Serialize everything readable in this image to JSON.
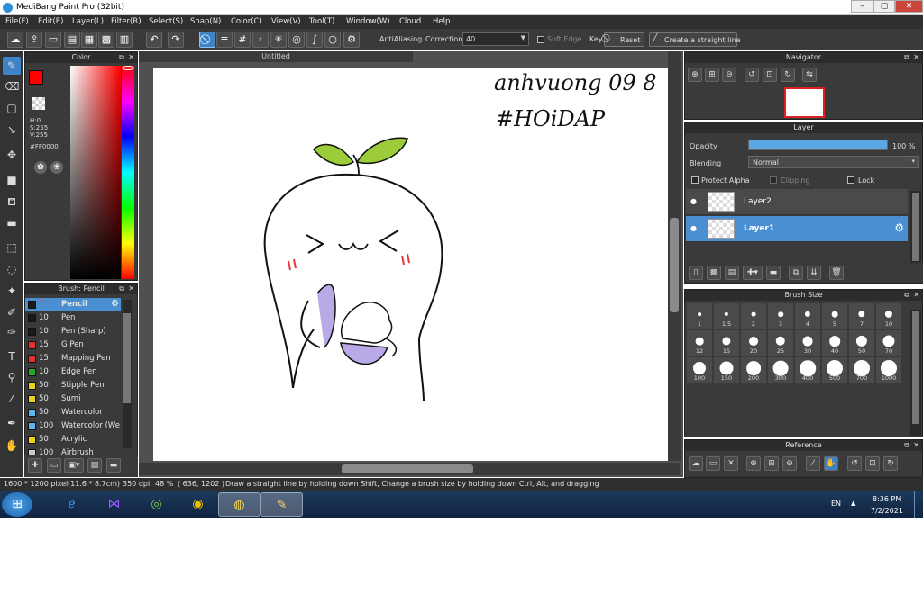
{
  "window": {
    "title": "MediBang Paint Pro (32bit)",
    "min": "–",
    "max": "▢",
    "close": "✕"
  },
  "menu": [
    "File(F)",
    "Edit(E)",
    "Layer(L)",
    "Filter(R)",
    "Select(S)",
    "Snap(N)",
    "Color(C)",
    "View(V)",
    "Tool(T)",
    "Window(W)",
    "Cloud",
    "Help"
  ],
  "toolbar": {
    "antialiasing_label": "AntiAliasing",
    "correction_label": "Correction",
    "correction_value": "40",
    "soft_edge_label": "Soft Edge",
    "key_label": "Key",
    "reset_label": "Reset",
    "straight_line_label": "Create a straight line"
  },
  "color_panel": {
    "title": "Color",
    "h": "H:0",
    "s": "S:255",
    "v": "V:255",
    "hex": "#FF0000",
    "primary": "#ff0000"
  },
  "brush_panel": {
    "title": "Brush: Pencil",
    "items": [
      {
        "size": "7",
        "name": "Pencil",
        "color": "#1a1a1a"
      },
      {
        "size": "10",
        "name": "Pen",
        "color": "#1a1a1a"
      },
      {
        "size": "10",
        "name": "Pen (Sharp)",
        "color": "#1a1a1a"
      },
      {
        "size": "15",
        "name": "G Pen",
        "color": "#e53030"
      },
      {
        "size": "15",
        "name": "Mapping Pen",
        "color": "#e53030"
      },
      {
        "size": "10",
        "name": "Edge Pen",
        "color": "#27a827"
      },
      {
        "size": "50",
        "name": "Stipple Pen",
        "color": "#e8d21f"
      },
      {
        "size": "50",
        "name": "Sumi",
        "color": "#e8d21f"
      },
      {
        "size": "50",
        "name": "Watercolor",
        "color": "#5fb6ee"
      },
      {
        "size": "100",
        "name": "Watercolor (We",
        "color": "#5fb6ee"
      },
      {
        "size": "50",
        "name": "Acrylic",
        "color": "#e8d21f"
      },
      {
        "size": "100",
        "name": "Airbrush",
        "color": "#cccccc"
      }
    ]
  },
  "canvas": {
    "tab": "Untitled",
    "handwriting_line1": "anhvuong 09 8",
    "handwriting_line2": "#HOiDAP"
  },
  "navigator": {
    "title": "Navigator"
  },
  "layer_panel": {
    "title": "Layer",
    "opacity_label": "Opacity",
    "opacity_value": "100 %",
    "opacity_fraction": 1.0,
    "blending_label": "Blending",
    "blending_value": "Normal",
    "protect_alpha": "Protect Alpha",
    "clipping": "Clipping",
    "lock": "Lock",
    "layers": [
      "Layer2",
      "Layer1"
    ]
  },
  "brush_size": {
    "title": "Brush Size",
    "sizes": [
      "1",
      "1.5",
      "2",
      "3",
      "4",
      "5",
      "7",
      "10",
      "12",
      "15",
      "20",
      "25",
      "30",
      "40",
      "50",
      "70",
      "100",
      "150",
      "200",
      "300",
      "400",
      "500",
      "700",
      "1000"
    ]
  },
  "reference": {
    "title": "Reference"
  },
  "status": {
    "size": "1600 * 1200 pixel",
    "physical": "(11.6 * 8.7cm)",
    "dpi": "350 dpi",
    "zoom": "48 %",
    "coords": "( 636, 1202 )",
    "hint": "Draw a straight line by holding down Shift, Change a brush size by holding down Ctrl, Alt, and dragging"
  },
  "taskbar": {
    "lang": "EN",
    "time": "8:36 PM",
    "date": "7/2/2021"
  }
}
